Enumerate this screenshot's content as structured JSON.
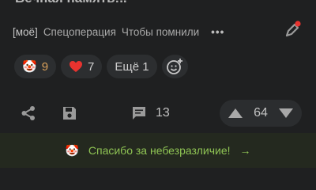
{
  "post": {
    "title_partial": "Вечная память!.."
  },
  "tags": [
    "[моё]",
    "Спецоперация",
    "Чтобы помнили"
  ],
  "more_label": "•••",
  "reactions": {
    "clown_count": "9",
    "heart_count": "7",
    "more_label": "Ещё 1"
  },
  "actions": {
    "comments_count": "13",
    "rating": "64"
  },
  "banner": {
    "emoji": "🤡",
    "text": "Спасибо за небезразличие!",
    "arrow": "→"
  },
  "colors": {
    "accent_green": "#8fc454",
    "heart_red": "#e8332f",
    "clown_orange": "#d9a05a"
  },
  "icons": [
    "edit-icon",
    "share-icon",
    "save-icon",
    "comment-icon",
    "upvote-icon",
    "downvote-icon",
    "add-reaction-icon"
  ]
}
